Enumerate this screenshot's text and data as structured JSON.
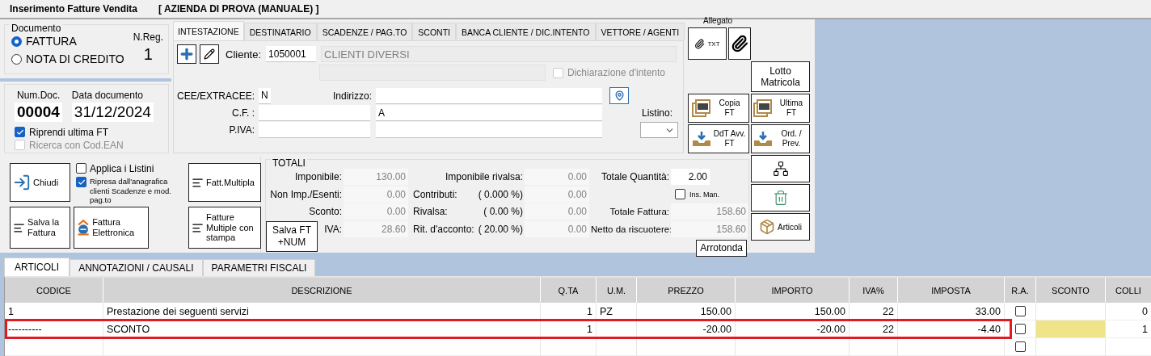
{
  "window": {
    "title": "Inserimento Fatture Vendita",
    "company": "[ AZIENDA DI PROVA (MANUALE) ]"
  },
  "documento": {
    "legend": "Documento",
    "types": [
      {
        "label": "FATTURA",
        "selected": true
      },
      {
        "label": "NOTA DI CREDITO",
        "selected": false
      }
    ],
    "nreg_label": "N.Reg.",
    "nreg": "1"
  },
  "numero": {
    "num_label": "Num.Doc.",
    "num": "00004",
    "date_label": "Data documento",
    "date": "31/12/2024",
    "options": [
      {
        "label": "Riprendi ultima FT",
        "checked": true,
        "disabled": false
      },
      {
        "label": "Ricerca con Cod.EAN",
        "checked": false,
        "disabled": true
      }
    ]
  },
  "header_tabs": [
    {
      "label": "INTESTAZIONE",
      "selected": true
    },
    {
      "label": "DESTINATARIO",
      "selected": false
    },
    {
      "label": "SCADENZE / PAG.TO",
      "selected": false
    },
    {
      "label": "SCONTI",
      "selected": false
    },
    {
      "label": "BANCA CLIENTE  / DIC.INTENTO",
      "selected": false
    },
    {
      "label": "VETTORE / AGENTI",
      "selected": false
    }
  ],
  "intestazione": {
    "cliente_label": "Cliente:",
    "cliente_code": "1050001",
    "cliente_name": "CLIENTI DIVERSI",
    "dichiarazione": {
      "label": "Dichiarazione d'intento",
      "checked": false
    },
    "cee_label": "CEE/EXTRACEE:",
    "cee": "N",
    "indirizzo_label": "Indirizzo:",
    "cf_label": "C.F. :",
    "piva_label": "P.IVA:",
    "address_line_2": "A",
    "listino_label": "Listino:"
  },
  "side": {
    "allegato_label": "Allegato",
    "allegato": [
      {
        "kind": "txt",
        "label": "TXT"
      },
      {
        "kind": "clip"
      }
    ],
    "lotto": "Lotto Matricola",
    "doc_buttons": [
      {
        "kind": "ft",
        "label": "Copia FT"
      },
      {
        "kind": "ft",
        "label": "Ultima FT"
      },
      {
        "kind": "tray",
        "label": "DdT Avv. FT"
      },
      {
        "kind": "tray",
        "label": "Ord. / Prev."
      }
    ],
    "tools": [
      {
        "kind": "tree"
      },
      {
        "kind": "bin"
      },
      {
        "kind": "box",
        "label": "Articoli"
      }
    ]
  },
  "actions": [
    {
      "kind": "exit",
      "label": "Chiudi"
    },
    {
      "kind": "doc",
      "label": "Fatt.Multipla"
    },
    {
      "kind": "doc",
      "label": "Salva la Fattura"
    },
    {
      "kind": "einvoice",
      "label": "Fattura Elettronica"
    },
    {
      "kind": "doc",
      "label": "Fatture Multiple con stampa"
    }
  ],
  "action_options": [
    {
      "label": "Applica i Listini",
      "checked": false
    },
    {
      "label": "Ripresa dall'anagrafica clienti Scadenze e mod. pag.to",
      "checked": true
    }
  ],
  "totali": {
    "legend": "TOTALI",
    "salva": "Salva FT +NUM",
    "col1": [
      {
        "label": "Imponibile:",
        "value": "130.00"
      },
      {
        "label": "Non Imp./Esenti:",
        "value": "0.00"
      },
      {
        "label": "Sconto:",
        "value": "0.00"
      },
      {
        "label": "IVA:",
        "value": "28.60"
      }
    ],
    "col2": [
      {
        "label": "Imponibile rivalsa:",
        "value": "0.00"
      },
      {
        "label": "Contributi:",
        "pct": "( 0.000 %)",
        "value": "0.00"
      },
      {
        "label": "Rivalsa:",
        "pct": "(  0.00 %)",
        "value": "0.00"
      },
      {
        "label": "Rit. d'acconto:",
        "pct": "( 20.00 %)",
        "value": "0.00"
      }
    ],
    "quantita": {
      "label": "Totale Quantità:",
      "value": "2.00"
    },
    "ins_man": {
      "label": "Ins. Man.",
      "checked": false
    },
    "col3": [
      {
        "label": "Totale Fattura:",
        "value": "158.60"
      },
      {
        "label": "Netto da riscuotere:",
        "value": "158.60"
      }
    ],
    "arrotonda": "Arrotonda"
  },
  "bottom_tabs": [
    {
      "label": "ARTICOLI",
      "selected": true
    },
    {
      "label": "ANNOTAZIONI  / CAUSALI",
      "selected": false
    },
    {
      "label": "PARAMETRI FISCALI",
      "selected": false
    }
  ],
  "table": {
    "columns": [
      "CODICE",
      "DESCRIZIONE",
      "Q.TA",
      "U.M.",
      "PREZZO",
      "IMPORTO",
      "IVA%",
      "IMPOSTA",
      "R.A.",
      "SCONTO",
      "COLLI"
    ],
    "rows": [
      {
        "codice": "1",
        "descrizione": "Prestazione dei seguenti servizi",
        "qta": "1",
        "um": "PZ",
        "prezzo": "150.00",
        "importo": "150.00",
        "iva": "22",
        "imposta": "33.00",
        "ra": false,
        "sconto_active": false,
        "colli": "0",
        "selected": false
      },
      {
        "codice": "----------",
        "descrizione": "SCONTO",
        "qta": "1",
        "prezzo": "-20.00",
        "importo": "-20.00",
        "iva": "22",
        "imposta": "-4.40",
        "ra": false,
        "sconto_active": true,
        "colli": "1",
        "selected": true
      },
      {
        "ra": false,
        "sconto_active": false,
        "selected": false
      }
    ]
  }
}
